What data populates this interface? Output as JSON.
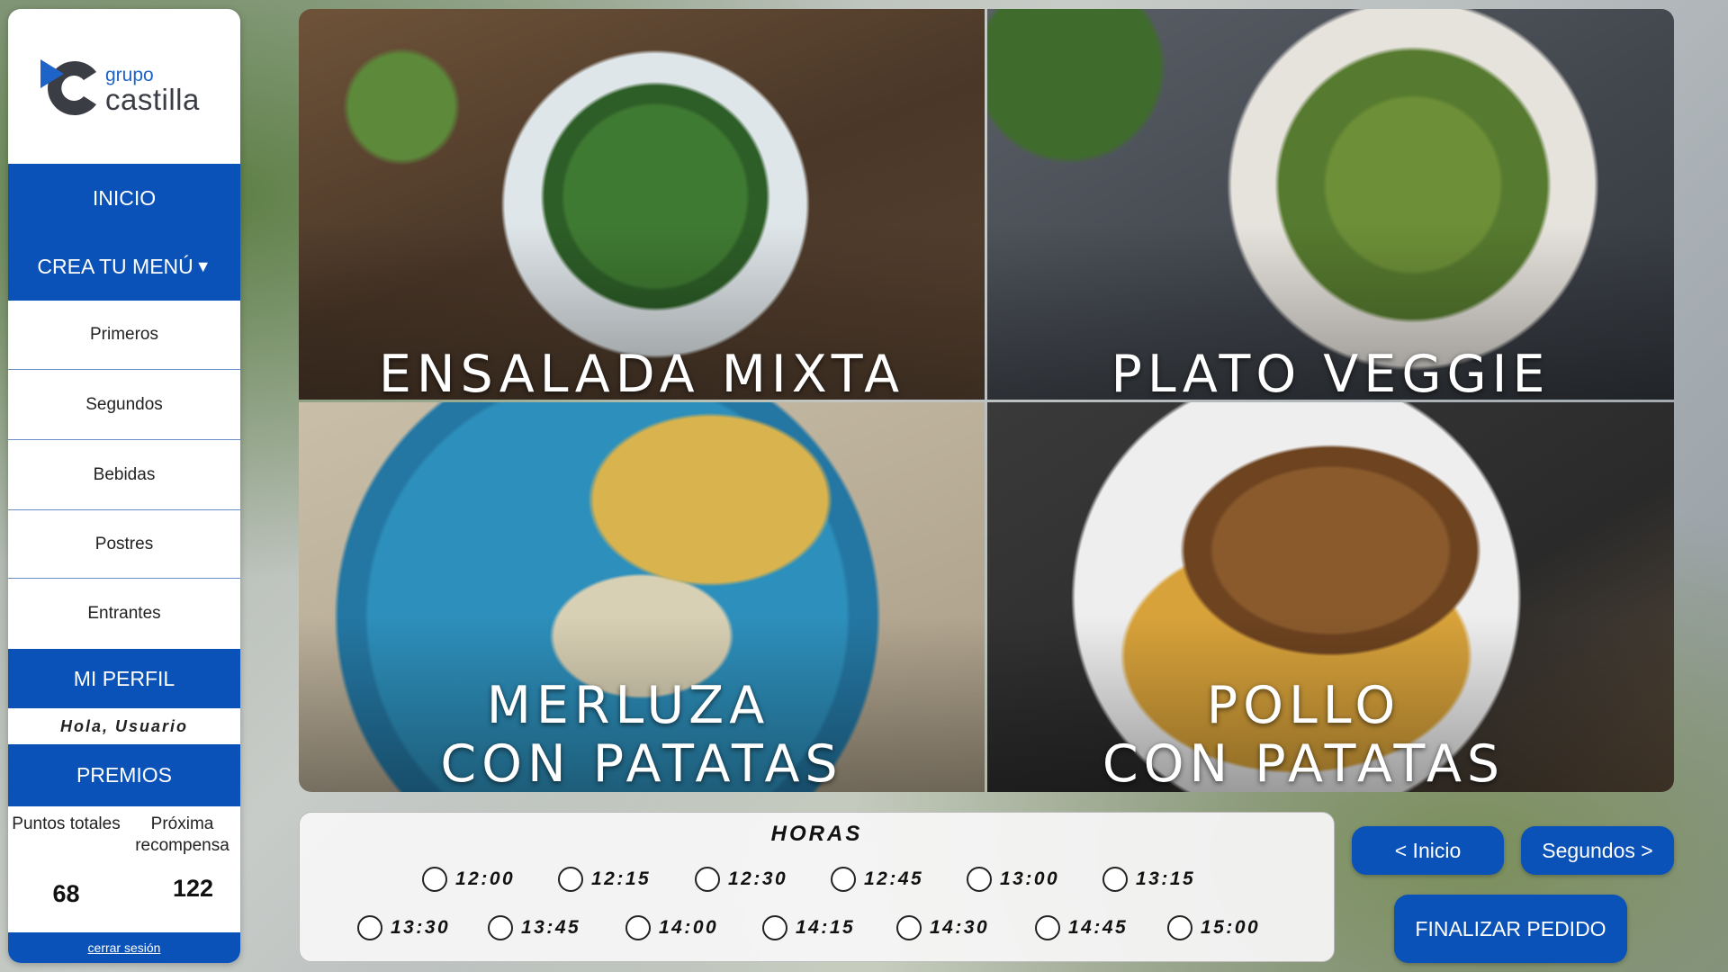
{
  "brand": {
    "prefix": "grupo",
    "name": "castilla"
  },
  "nav": {
    "home": "INICIO",
    "create_menu": "CREA TU MENÚ",
    "create_menu_arrow": "▼",
    "categories": [
      "Primeros",
      "Segundos",
      "Bebidas",
      "Postres",
      "Entrantes"
    ],
    "profile": "MI PERFIL",
    "greeting": "Hola, Usuario",
    "rewards": "PREMIOS",
    "points_label": "Puntos totales",
    "next_reward_label": "Próxima recompensa",
    "points_value": "68",
    "next_reward_value": "122",
    "logout": "cerrar sesión"
  },
  "dishes": [
    {
      "line1": "ENSALADA MIXTA",
      "line2": ""
    },
    {
      "line1": "PLATO VEGGIE",
      "line2": ""
    },
    {
      "line1": "MERLUZA",
      "line2": "CON PATATAS"
    },
    {
      "line1": "POLLO",
      "line2": "CON PATATAS"
    }
  ],
  "hours": {
    "title": "HORAS",
    "row1": [
      "12:00",
      "12:15",
      "12:30",
      "12:45",
      "13:00",
      "13:15"
    ],
    "row2": [
      "13:30",
      "13:45",
      "14:00",
      "14:15",
      "14:30",
      "14:45",
      "15:00"
    ]
  },
  "buttons": {
    "back": "< Inicio",
    "next": "Segundos >",
    "finish": "FINALIZAR PEDIDO"
  },
  "colors": {
    "primary": "#0a52b8",
    "divider": "#6a8fc8"
  }
}
